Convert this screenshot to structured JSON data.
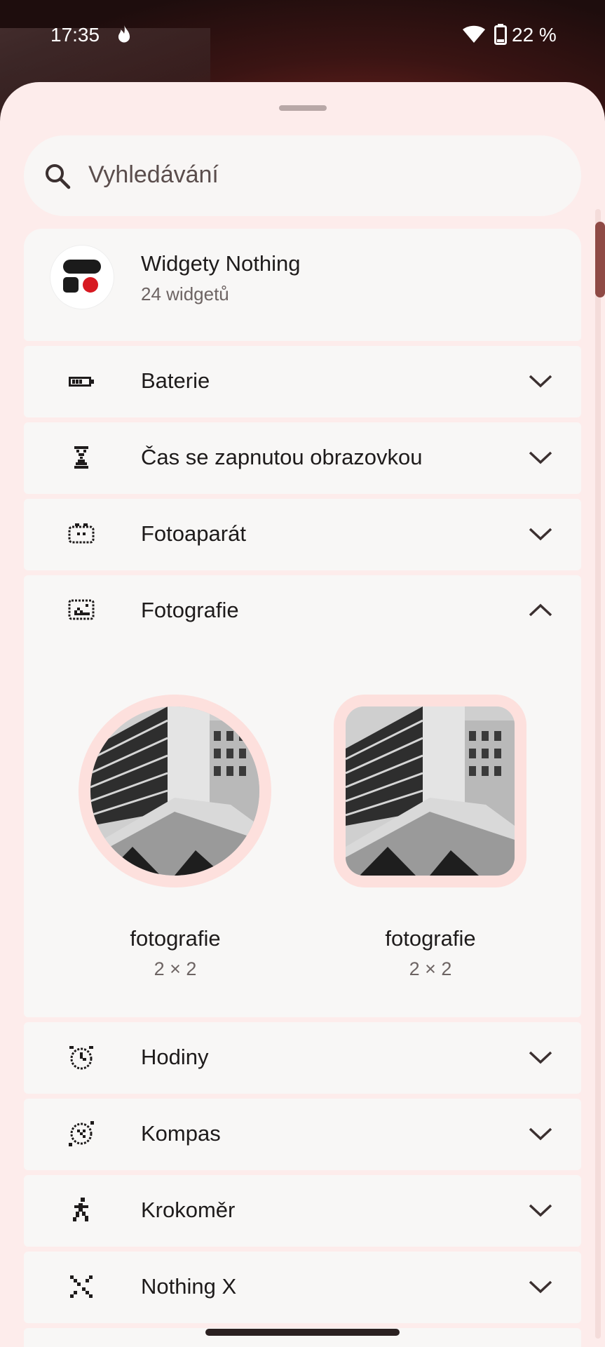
{
  "status_bar": {
    "time": "17:35",
    "battery_percent": "22 %",
    "icons": [
      "flame-icon",
      "wifi-icon",
      "battery-icon"
    ]
  },
  "search": {
    "placeholder": "Vyhledávání",
    "icon": "search-icon"
  },
  "app_header": {
    "title": "Widgety Nothing",
    "subtitle": "24 widgetů"
  },
  "sections": [
    {
      "label": "Baterie",
      "icon": "battery-dots-icon",
      "expanded": false
    },
    {
      "label": "Čas se zapnutou obrazovkou",
      "icon": "hourglass-icon",
      "expanded": false
    },
    {
      "label": "Fotoaparát",
      "icon": "camera-icon",
      "expanded": false
    },
    {
      "label": "Fotografie",
      "icon": "photo-icon",
      "expanded": true,
      "widgets": [
        {
          "name": "fotografie",
          "size": "2 × 2",
          "shape": "circle"
        },
        {
          "name": "fotografie",
          "size": "2 × 2",
          "shape": "rounded-square"
        }
      ]
    },
    {
      "label": "Hodiny",
      "icon": "alarm-clock-icon",
      "expanded": false
    },
    {
      "label": "Kompas",
      "icon": "compass-icon",
      "expanded": false
    },
    {
      "label": "Krokoměr",
      "icon": "walking-icon",
      "expanded": false
    },
    {
      "label": "Nothing X",
      "icon": "nothing-x-icon",
      "expanded": false
    }
  ],
  "colors": {
    "sheet_background": "#fdeceb",
    "card_background": "#f8f7f6",
    "accent_red": "#d71921",
    "scroll_thumb": "#8f4a45"
  }
}
